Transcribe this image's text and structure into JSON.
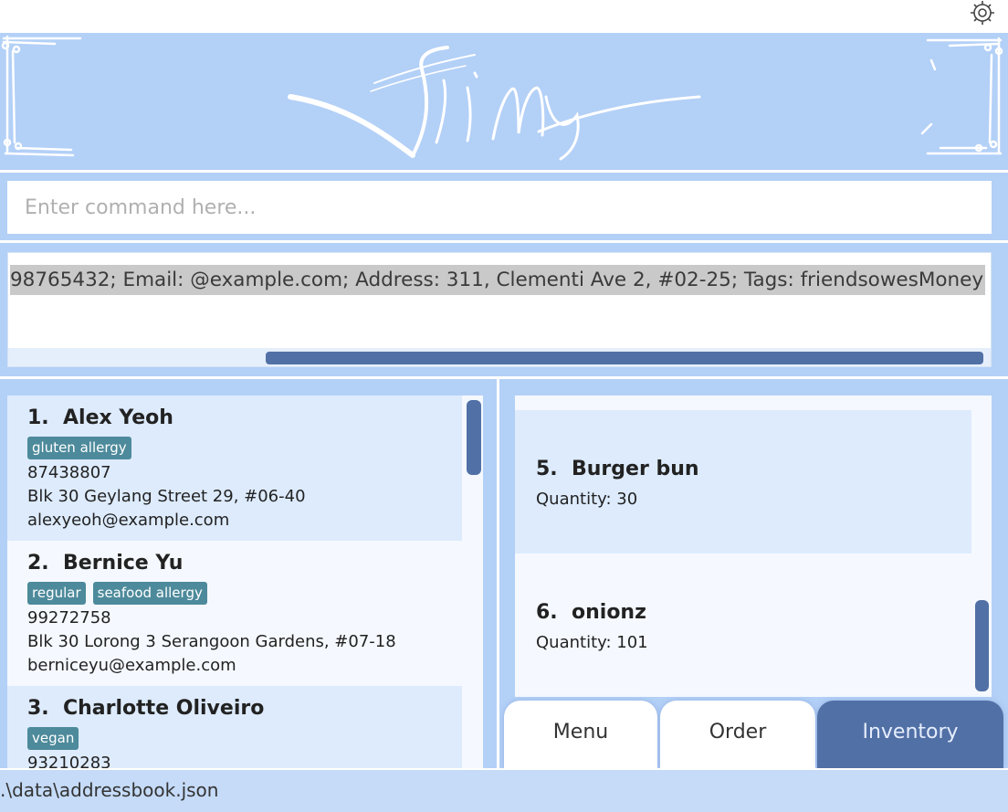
{
  "header": {
    "logo_text": "Jimy",
    "settings_icon": "gear-icon"
  },
  "command": {
    "placeholder": "Enter command here...",
    "value": ""
  },
  "result": {
    "text": "98765432; Email: @example.com; Address: 311, Clementi Ave 2, #02-25; Tags: friendsowesMoney"
  },
  "people": [
    {
      "index": "1.",
      "name": "Alex Yeoh",
      "tags": [
        "gluten allergy"
      ],
      "phone": "87438807",
      "address": "Blk 30 Geylang Street 29, #06-40",
      "email": "alexyeoh@example.com"
    },
    {
      "index": "2.",
      "name": "Bernice Yu",
      "tags": [
        "regular",
        "seafood allergy"
      ],
      "phone": "99272758",
      "address": "Blk 30 Lorong 3 Serangoon Gardens, #07-18",
      "email": "berniceyu@example.com"
    },
    {
      "index": "3.",
      "name": "Charlotte Oliveiro",
      "tags": [
        "vegan"
      ],
      "phone": "93210283",
      "address": "",
      "email": ""
    }
  ],
  "inventory": [
    {
      "index": "5.",
      "name": "Burger bun",
      "quantity": "Quantity: 30"
    },
    {
      "index": "6.",
      "name": "onionz",
      "quantity": "Quantity: 101"
    }
  ],
  "tabs": [
    {
      "label": "Menu",
      "active": false
    },
    {
      "label": "Order",
      "active": false
    },
    {
      "label": "Inventory",
      "active": true
    }
  ],
  "status": {
    "path": ".\\data\\addressbook.json"
  },
  "colors": {
    "panel": "#b3d0f7",
    "accent": "#5170a6",
    "tag": "#4d8a9b"
  }
}
